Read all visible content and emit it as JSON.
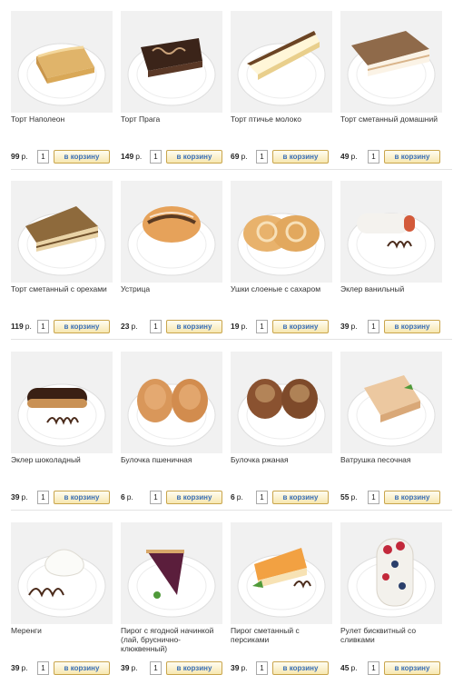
{
  "currency": "р.",
  "cart_label": "в корзину",
  "default_qty": "1",
  "products": [
    {
      "name": "Торт Наполеон",
      "price": "99"
    },
    {
      "name": "Торт Прага",
      "price": "149"
    },
    {
      "name": "Торт птичье молоко",
      "price": "69"
    },
    {
      "name": "Торт сметанный домашний",
      "price": "49"
    },
    {
      "name": "Торт сметанный с орехами",
      "price": "119"
    },
    {
      "name": "Устрица",
      "price": "23"
    },
    {
      "name": "Ушки слоеные с сахаром",
      "price": "19"
    },
    {
      "name": "Эклер ванильный",
      "price": "39"
    },
    {
      "name": "Эклер шоколадный",
      "price": "39"
    },
    {
      "name": "Булочка пшеничная",
      "price": "6"
    },
    {
      "name": "Булочка ржаная",
      "price": "6"
    },
    {
      "name": "Ватрушка песочная",
      "price": "55"
    },
    {
      "name": "Меренги",
      "price": "39"
    },
    {
      "name": "Пирог с ягодной начинкой (лай, бруснично-клюквенный)",
      "price": "39"
    },
    {
      "name": "Пирог сметанный с персиками",
      "price": "39"
    },
    {
      "name": "Рулет бисквитный со сливками",
      "price": "45"
    }
  ],
  "icons": [
    "napoleon-cake-photo",
    "praga-cake-photo",
    "bird-milk-cake-photo",
    "sour-cream-cake-photo",
    "nut-cake-photo",
    "oyster-pastry-photo",
    "puff-ears-photo",
    "vanilla-eclair-photo",
    "chocolate-eclair-photo",
    "wheat-bun-photo",
    "rye-bun-photo",
    "vatrushka-photo",
    "meringue-photo",
    "berry-pie-photo",
    "peach-pie-photo",
    "cream-roll-photo"
  ]
}
